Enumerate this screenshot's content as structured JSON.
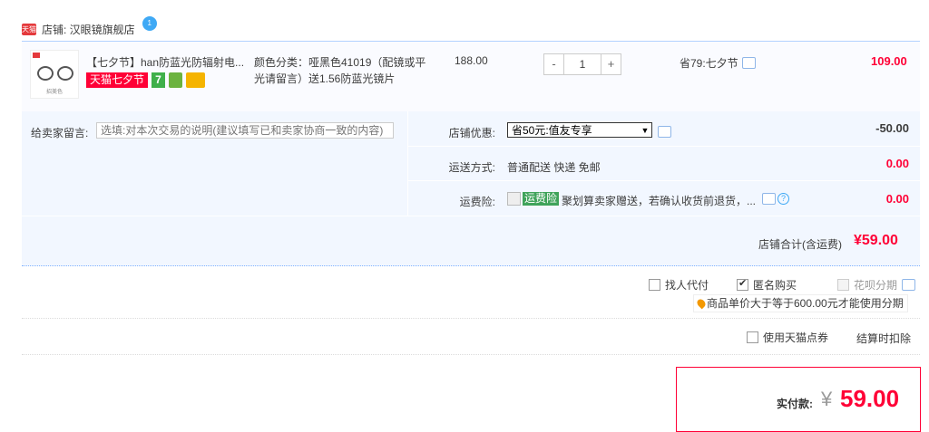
{
  "shop": {
    "badge": "天猫",
    "name": "店铺: 汉眼镜旗舰店",
    "chat_badge": "1"
  },
  "item": {
    "thumb_caption": "招美色",
    "title": "【七夕节】han防蓝光防辐射电...",
    "tags": {
      "festival": "天猫七夕节",
      "seven": "7"
    },
    "sku": "颜色分类：哑黑色41019（配镜或平光请留言）送1.56防蓝光镜片",
    "unit_price": "188.00",
    "quantity": "1",
    "qty_minus": "-",
    "qty_plus": "+",
    "discount": "省79:七夕节",
    "total": "109.00"
  },
  "memo": {
    "label": "给卖家留言:",
    "placeholder": "选填:对本次交易的说明(建议填写已和卖家协商一致的内容)"
  },
  "promo": {
    "label": "店铺优惠:",
    "selected": "省50元:值友专享",
    "amount": "-50.00"
  },
  "shipping": {
    "label": "运送方式:",
    "value": "普通配送 快递 免邮",
    "amount": "0.00"
  },
  "insurance": {
    "label": "运费险:",
    "tag": "运费险",
    "text": "聚划算卖家赠送，若确认收货前退货，...",
    "amount": "0.00"
  },
  "shop_total": {
    "label": "店铺合计(含运费)",
    "value": "¥59.00"
  },
  "options": {
    "proxy_pay": "找人代付",
    "anonymous": "匿名购买",
    "huabei": "花呗分期",
    "installment_tip": "商品单价大于等于600.00元才能使用分期",
    "tmall_points": "使用天猫点券",
    "points_note": "结算时扣除"
  },
  "payment": {
    "label": "实付款:",
    "currency": "¥",
    "amount": "59.00"
  },
  "colors": {
    "accent": "#ff0036",
    "panel": "#f2f7ff",
    "border": "#b2d1ff"
  }
}
